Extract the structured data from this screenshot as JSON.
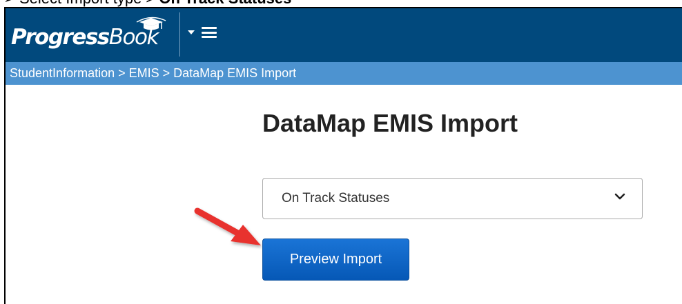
{
  "caption": {
    "bullet": "➢",
    "prefix": "Select Import type > ",
    "emphasis": "On Track Statuses"
  },
  "app": {
    "logo_main": "Progress",
    "logo_book": "Book",
    "brand_color": "#01497d",
    "breadcrumb_color": "#4d93d0"
  },
  "breadcrumb": "StudentInformation > EMIS > DataMap EMIS Import",
  "page": {
    "title": "DataMap EMIS Import"
  },
  "import_type": {
    "selected": "On Track Statuses"
  },
  "buttons": {
    "preview": "Preview Import",
    "preview_color": "#0a66c8"
  },
  "annotation": {
    "arrow_color": "#e8322f"
  },
  "icons": {
    "menu": "hamburger-icon",
    "dropdown": "caret-down-icon",
    "select": "chevron-down-icon",
    "logo": "graduation-cap-icon"
  }
}
